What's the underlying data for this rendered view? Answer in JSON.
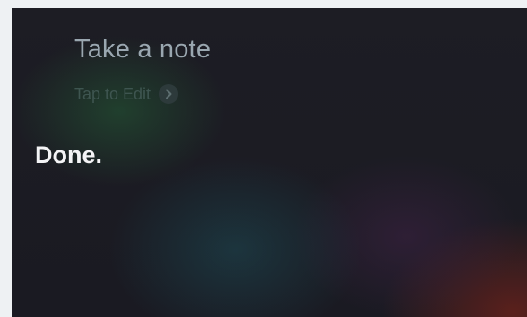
{
  "siri": {
    "utterance": "Take a note",
    "edit_label": "Tap to Edit",
    "edit_icon": "chevron-right-icon",
    "response": "Done."
  }
}
